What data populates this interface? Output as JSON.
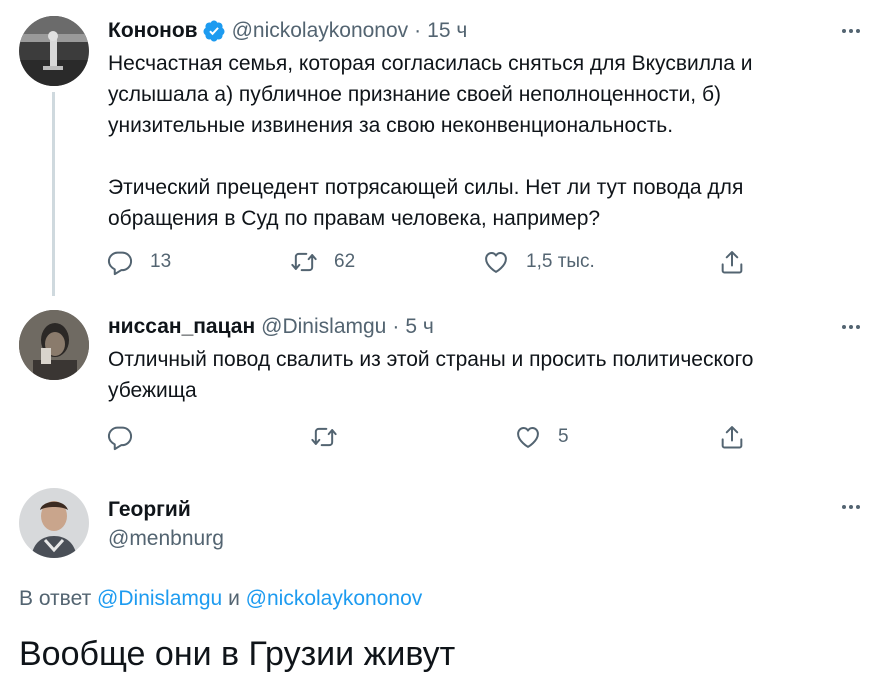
{
  "tweets": [
    {
      "name": "Кононов",
      "verified": true,
      "handle": "@nickolaykononov",
      "separator": "·",
      "time": "15 ч",
      "text": "Несчастная семья, которая согласилась сняться для Вкусвилла и\nуслышала а) публичное признание своей неполноценности, б)\nунизительные извинения за свою неконвенциональность.\n\nЭтический прецедент потрясающей силы. Нет ли тут повода для\nобращения в Суд по правам человека, например?",
      "replies": "13",
      "retweets": "62",
      "likes": "1,5 тыс."
    },
    {
      "name": "ниссан_пацан",
      "handle": "@Dinislamgu",
      "separator": "·",
      "time": "5 ч",
      "text": "Отличный повод свалить из этой страны и просить политического\nубежища",
      "likes": "5"
    }
  ],
  "main_tweet": {
    "name": "Георгий",
    "handle": "@menbnurg",
    "replying_prefix": "В ответ",
    "replying_to_1": "@Dinislamgu",
    "replying_and": "и",
    "replying_to_2": "@nickolaykononov",
    "text": "Вообще они в Грузии живут"
  },
  "colors": {
    "accent": "#1d9bf0",
    "secondary_text": "#536471",
    "thread_line": "#cfd9de"
  }
}
